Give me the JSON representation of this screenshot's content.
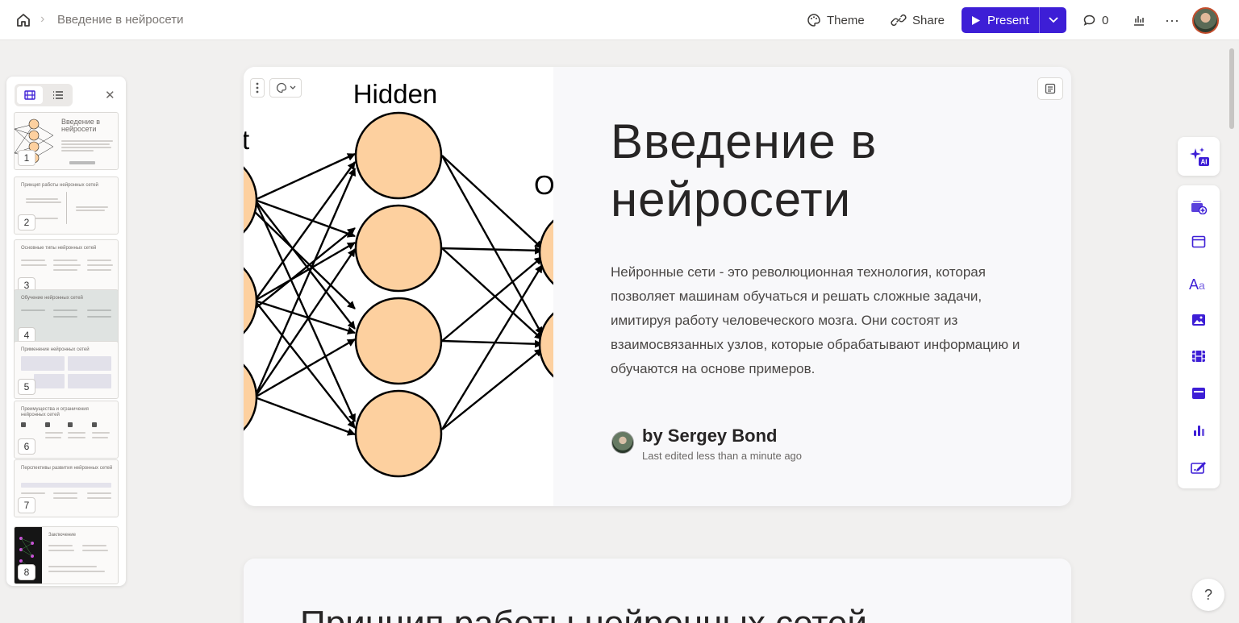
{
  "breadcrumb": {
    "title": "Введение в нейросети"
  },
  "toolbar": {
    "theme_label": "Theme",
    "share_label": "Share",
    "present_label": "Present",
    "comments_count": "0"
  },
  "thumbnails": [
    {
      "num": "1",
      "title": "Введение в нейросети"
    },
    {
      "num": "2",
      "title": "Принцип работы нейронных сетей"
    },
    {
      "num": "3",
      "title": "Основные типы нейронных сетей"
    },
    {
      "num": "4",
      "title": "Обучение нейронных сетей"
    },
    {
      "num": "5",
      "title": "Применение нейронных сетей"
    },
    {
      "num": "6",
      "title": "Преимущества и ограничения нейронных сетей"
    },
    {
      "num": "7",
      "title": "Перспективы развития нейронных сетей"
    },
    {
      "num": "8",
      "title": "Заключение"
    }
  ],
  "slide": {
    "image_labels": {
      "hidden": "Hidden",
      "left_fragment": "t",
      "right_fragment": "O"
    },
    "title": "Введение в нейросети",
    "body": " Нейронные сети - это революционная технология, которая позволяет машинам обучаться и решать сложные задачи, имитируя работу человеческого мозга. Они состоят из взаимосвязанных узлов, которые обрабатывают информацию и обучаются на основе примеров.",
    "author": "by Sergey Bond",
    "edited": "Last edited less than a minute ago"
  },
  "next_slide": {
    "title": "Принцип работы нейронных сетей"
  },
  "right_tools": [
    "ai-icon",
    "card-add-icon",
    "layout-icon",
    "text-icon",
    "image-icon",
    "video-icon",
    "embed-icon",
    "chart-icon",
    "form-icon"
  ],
  "help_label": "?",
  "colors": {
    "accent": "#3d1ed6",
    "node": "#fdd09f"
  }
}
